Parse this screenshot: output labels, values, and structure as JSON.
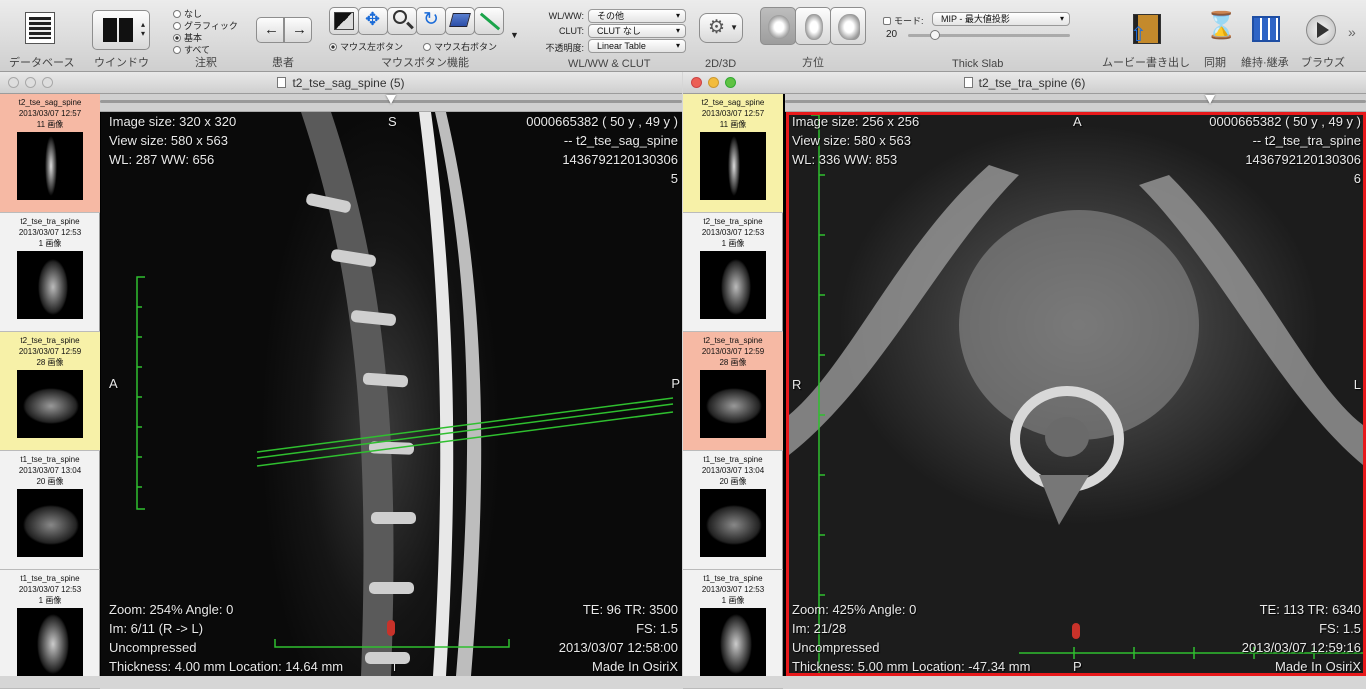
{
  "toolbar": {
    "database_label": "データベース",
    "window_label": "ウインドウ",
    "annotation_label": "注釈",
    "annotation_options": [
      "なし",
      "グラフィック",
      "基本",
      "すべて"
    ],
    "annotation_selected": "基本",
    "patient_label": "患者",
    "mouse_label": "マウスボタン機能",
    "mouse_left": "マウス左ボタン",
    "mouse_right": "マウス右ボタン",
    "wlww_label": "WL/WW & CLUT",
    "wlww_field": "WL/WW:",
    "wlww_value": "その他",
    "clut_field": "CLUT:",
    "clut_value": "CLUT なし",
    "opacity_field": "不透明度:",
    "opacity_value": "Linear Table",
    "dim_label": "2D/3D",
    "orientation_label": "方位",
    "thick_label": "Thick Slab",
    "mode_field": "モード:",
    "mode_value": "MIP - 最大値投影",
    "thick_value": "20",
    "movie_label": "ムービー書き出し",
    "sync_label": "同期",
    "keep_label": "維持·継承",
    "browse_label": "ブラウズ",
    "gear_icon": "gear-icon",
    "play_icon": "play-icon"
  },
  "left_window": {
    "title": "t2_tse_sag_spine (5)",
    "overlay_tl": [
      "Image size: 320 x 320",
      "View size: 580 x 563",
      "WL: 287 WW: 656"
    ],
    "overlay_tr": [
      "0000665382 (  50 y ,  49 y )",
      "-- t2_tse_sag_spine",
      "1436792120130306",
      "5"
    ],
    "overlay_bl": [
      "Zoom: 254% Angle: 0",
      "Im: 6/11  (R -> L)",
      "Uncompressed",
      "Thickness: 4.00 mm Location: 14.64 mm"
    ],
    "overlay_br": [
      "TE:  96 TR:  3500",
      "FS:  1.5",
      "2013/03/07 12:58:00",
      "Made In OsiriX"
    ],
    "orient_top": "S",
    "orient_left": "A",
    "orient_right": "P",
    "orient_bottom": "I"
  },
  "right_window": {
    "title": "t2_tse_tra_spine (6)",
    "overlay_tl": [
      "Image size: 256 x 256",
      "View size: 580 x 563",
      "WL: 336 WW: 853"
    ],
    "overlay_tr": [
      "0000665382 (  50 y ,  49 y )",
      "-- t2_tse_tra_spine",
      "1436792120130306",
      "6"
    ],
    "overlay_bl": [
      "Zoom: 425% Angle: 0",
      "Im: 21/28",
      "Uncompressed",
      "Thickness: 5.00 mm Location: -47.34 mm"
    ],
    "overlay_br": [
      "TE:  113 TR:  6340",
      "FS:  1.5",
      "2013/03/07 12:59:16",
      "Made In OsiriX"
    ],
    "orient_top": "A",
    "orient_left": "R",
    "orient_right": "L",
    "orient_bottom": "P"
  },
  "series": [
    {
      "name": "t2_tse_sag_spine",
      "date": "2013/03/07 12:57",
      "count": "11 画像"
    },
    {
      "name": "t2_tse_tra_spine",
      "date": "2013/03/07 12:53",
      "count": "1 画像"
    },
    {
      "name": "t2_tse_tra_spine",
      "date": "2013/03/07 12:59",
      "count": "28 画像"
    },
    {
      "name": "t1_tse_tra_spine",
      "date": "2013/03/07 13:04",
      "count": "20 画像"
    },
    {
      "name": "t1_tse_tra_spine",
      "date": "2013/03/07 12:53",
      "count": "1 画像"
    }
  ],
  "colors": {
    "selected_series": "#f6b9a4",
    "highlight_series": "#f7f1a8",
    "active_border": "#e8191b",
    "crosshair": "#2fbf2f"
  }
}
